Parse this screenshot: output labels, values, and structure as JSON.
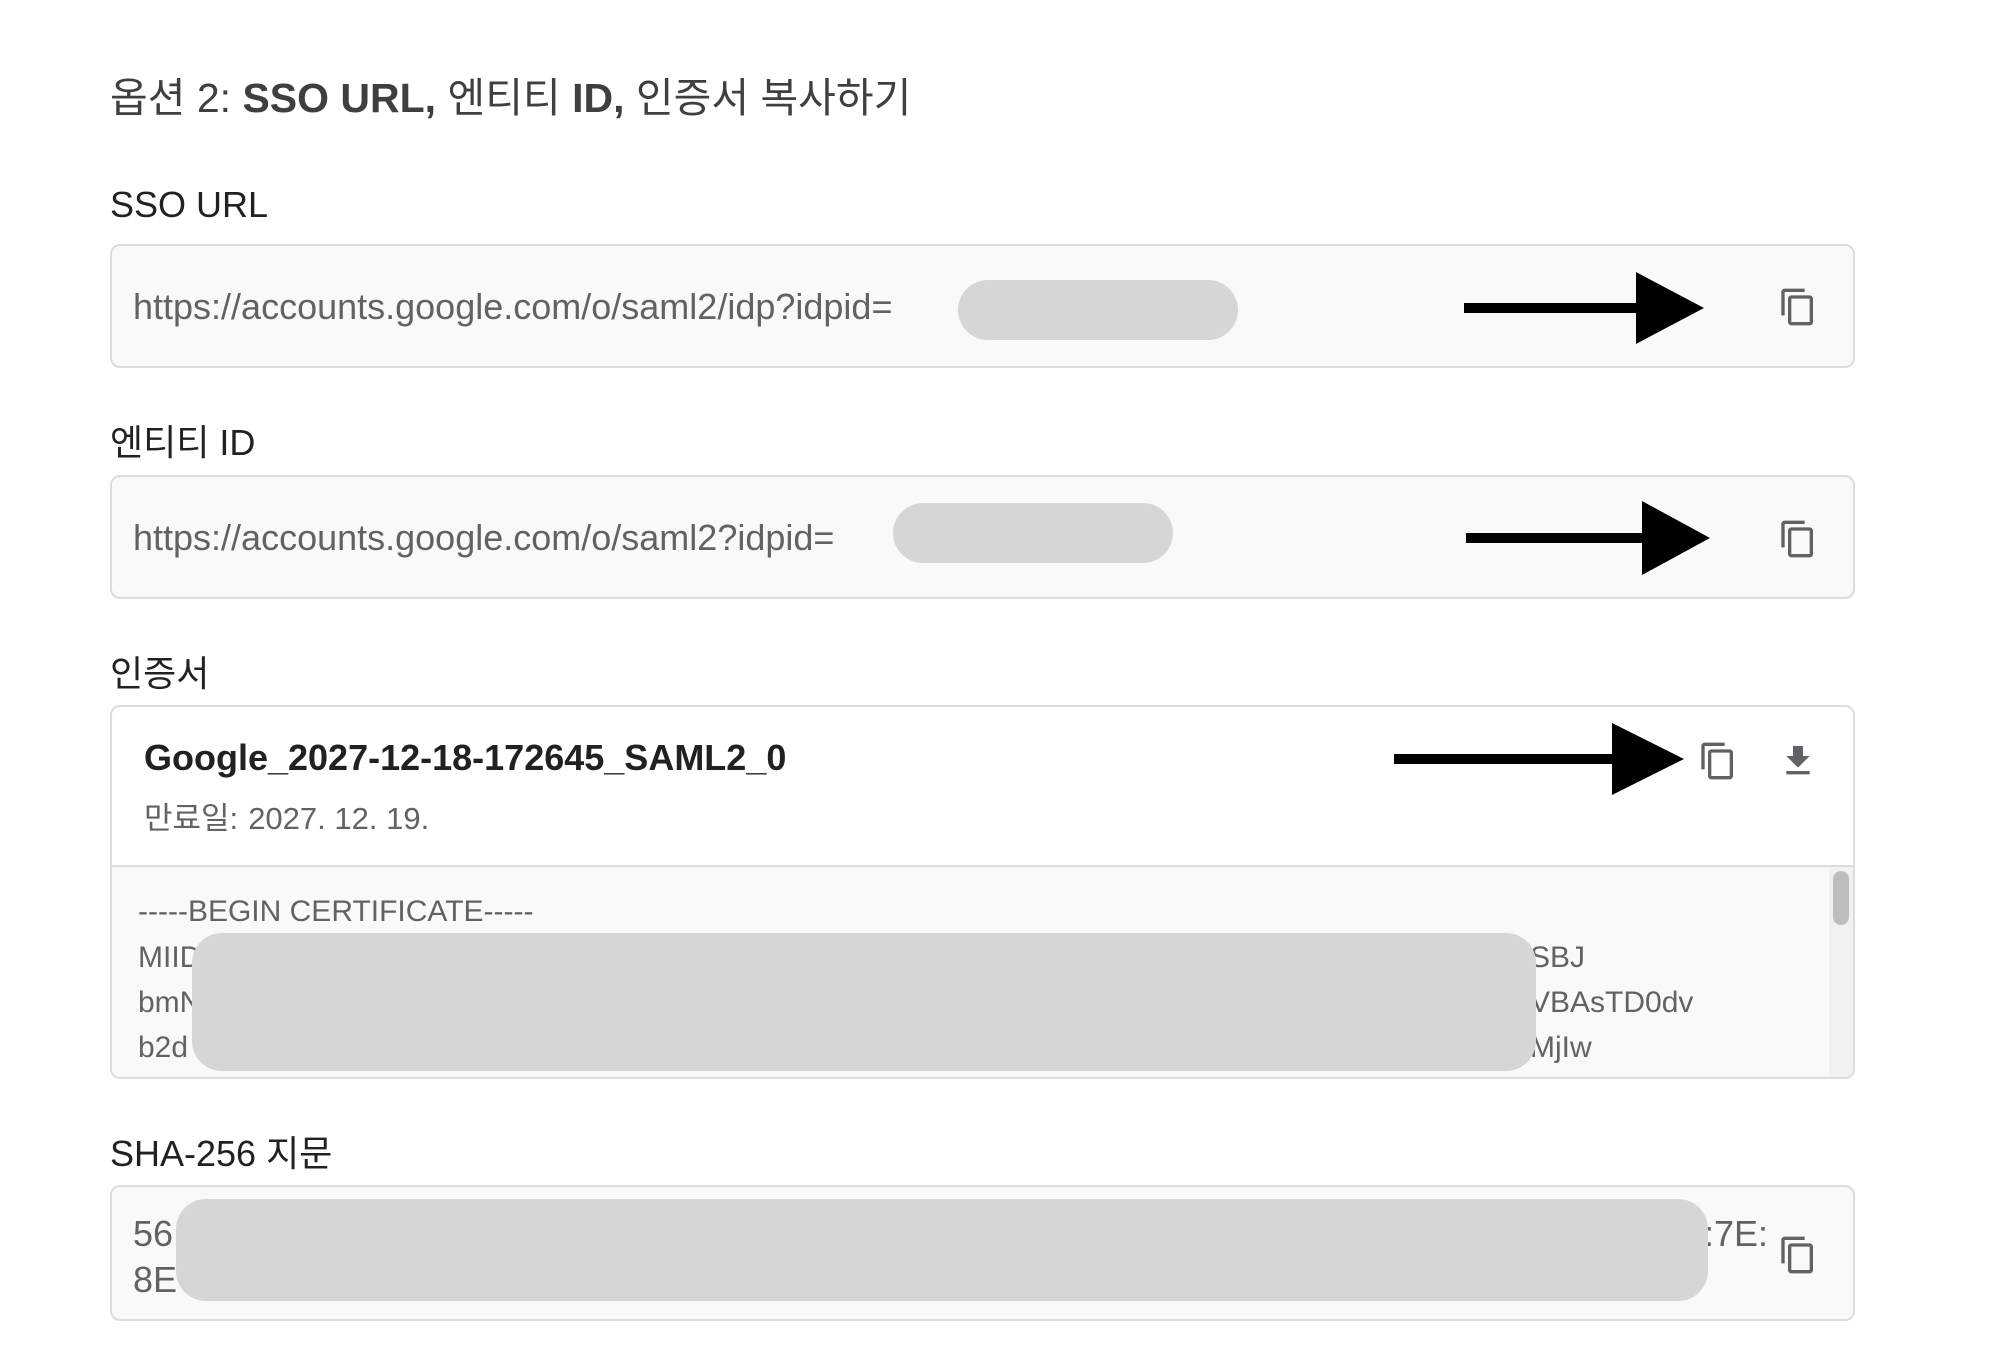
{
  "heading": {
    "prefix": "옵션 2:",
    "sso": "SSO URL,",
    "entity_word": "엔티티",
    "id": "ID,",
    "suffix": "인증서 복사하기"
  },
  "sso_url": {
    "label": "SSO URL",
    "value_prefix": "https://accounts.google.com/o/saml2/idp?idpid="
  },
  "entity_id": {
    "label": "엔티티 ID",
    "value_prefix": "https://accounts.google.com/o/saml2?idpid="
  },
  "certificate": {
    "label": "인증서",
    "name": "Google_2027-12-18-172645_SAML2_0",
    "expiry_label": "만료일:",
    "expiry_date": "2027. 12. 19.",
    "pem": {
      "begin": "-----BEGIN CERTIFICATE-----",
      "lines": [
        {
          "start": "MIID",
          "end": "SBJ"
        },
        {
          "start": "bmN",
          "end": "VBAsTD0dv"
        },
        {
          "start": "b2d",
          "end": "MjIw"
        }
      ]
    }
  },
  "fingerprint": {
    "label": "SHA-256 지문",
    "line1_start": "56",
    "line1_end": ":7E:",
    "line2_start": "8E"
  },
  "icons": {
    "copy": "copy-icon",
    "download": "download-icon",
    "arrow": "arrow-right-icon"
  },
  "colors": {
    "redaction": "#d6d6d6",
    "border": "#dadce0",
    "field_bg": "#f8f9fa",
    "icon": "#5f6368"
  }
}
